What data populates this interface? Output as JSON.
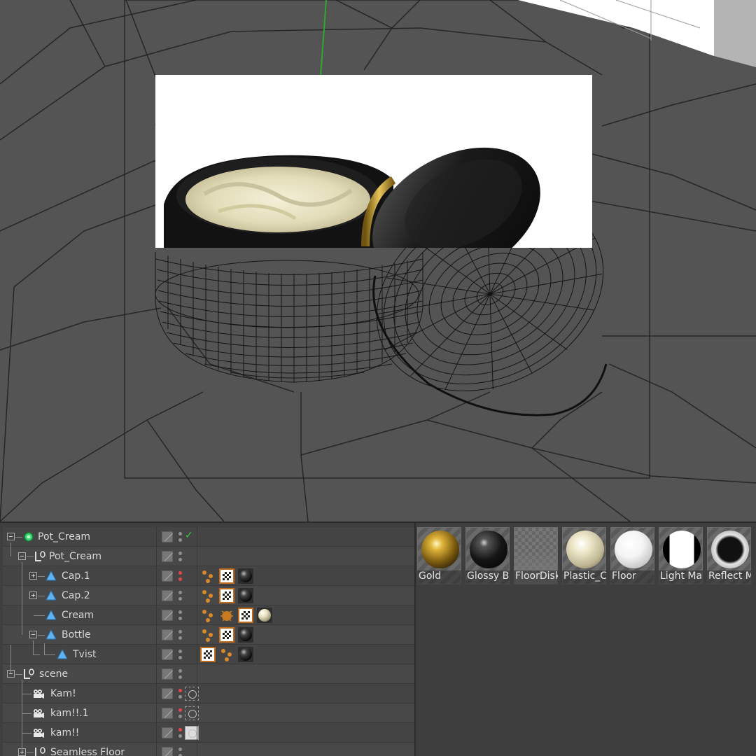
{
  "viewport": {
    "background": "#545454",
    "render_region_background": "#ffffff",
    "y_axis_color": "#2ea82e"
  },
  "object_manager": {
    "rows": [
      {
        "label": "Pot_Cream",
        "icon": "null-object-icon",
        "visible_check": true
      },
      {
        "label": "Pot_Cream",
        "icon": "null-group-icon"
      },
      {
        "label": "Cap.1",
        "icon": "polygon-object-icon"
      },
      {
        "label": "Cap.2",
        "icon": "polygon-object-icon"
      },
      {
        "label": "Cream",
        "icon": "polygon-object-icon"
      },
      {
        "label": "Bottle",
        "icon": "polygon-object-icon"
      },
      {
        "label": "Tvist",
        "icon": "polygon-object-icon"
      },
      {
        "label": "scene",
        "icon": "null-group-icon"
      },
      {
        "label": "Kam!",
        "icon": "camera-icon"
      },
      {
        "label": "kam!!.1",
        "icon": "camera-icon"
      },
      {
        "label": "kam!!",
        "icon": "camera-icon"
      },
      {
        "label": "Seamless Floor",
        "icon": "null-group-icon"
      }
    ]
  },
  "material_manager": {
    "materials": [
      {
        "label": "Gold",
        "color": "#b58a18"
      },
      {
        "label": "Glossy Bl",
        "color": "#1c1c1c"
      },
      {
        "label": "FloorDisk",
        "color": "#7a7a7a"
      },
      {
        "label": "Plastic_C",
        "color": "#e9e4c8"
      },
      {
        "label": "Floor",
        "color": "#f2f2f2"
      },
      {
        "label": "Light Ma",
        "color": "#ffffff"
      },
      {
        "label": "Reflect M",
        "color": "#d8d8d8"
      }
    ]
  }
}
